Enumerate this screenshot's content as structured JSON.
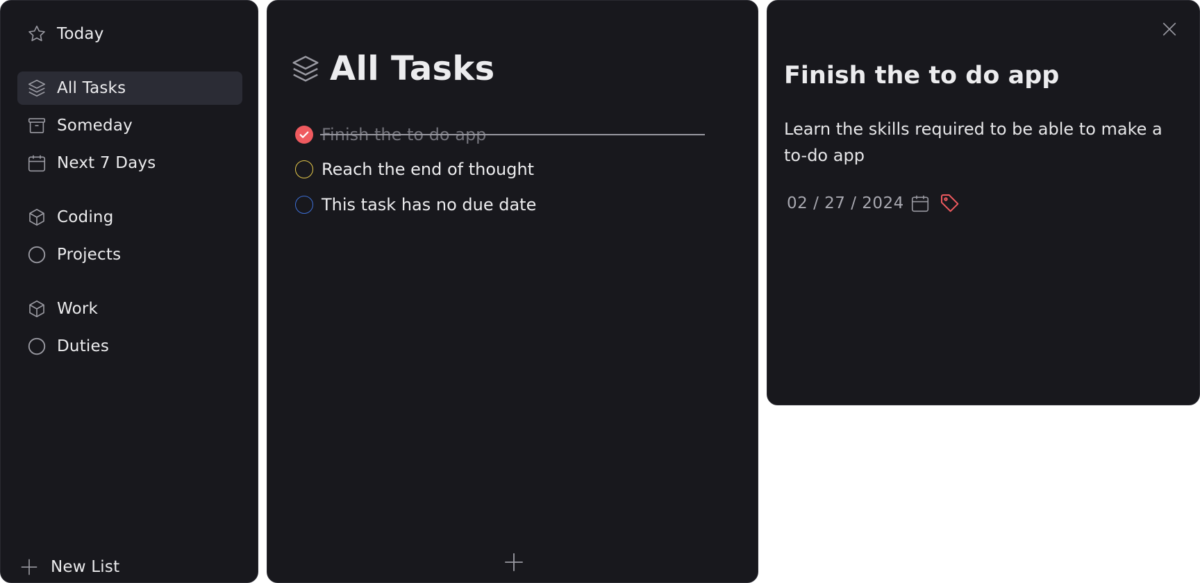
{
  "sidebar": {
    "items": [
      {
        "label": "Today",
        "icon": "star-icon"
      },
      {
        "label": "All Tasks",
        "icon": "layers-icon",
        "active": true
      },
      {
        "label": "Someday",
        "icon": "archive-icon"
      },
      {
        "label": "Next 7 Days",
        "icon": "calendar-icon"
      },
      {
        "label": "Coding",
        "icon": "cube-icon"
      },
      {
        "label": "Projects",
        "icon": "circle-icon"
      },
      {
        "label": "Work",
        "icon": "cube-icon"
      },
      {
        "label": "Duties",
        "icon": "circle-icon"
      }
    ],
    "new_list_label": "New List"
  },
  "main": {
    "title": "All Tasks",
    "tasks": [
      {
        "label": "Finish the to do app",
        "done": true,
        "color": "#ef5a5f"
      },
      {
        "label": "Reach the end of thought",
        "done": false,
        "color": "#e6c94a"
      },
      {
        "label": "This task has no due date",
        "done": false,
        "color": "#3d6fd6"
      }
    ]
  },
  "detail": {
    "title": "Finish the to do app",
    "description": "Learn the skills required to be able to make a to-do app",
    "date": "02 / 27 / 2024",
    "tag_color": "#ef5a5f"
  },
  "colors": {
    "panel_bg": "#18181d",
    "active_bg": "#2b2c35",
    "text": "#ececee",
    "muted": "#a8a8b0"
  }
}
